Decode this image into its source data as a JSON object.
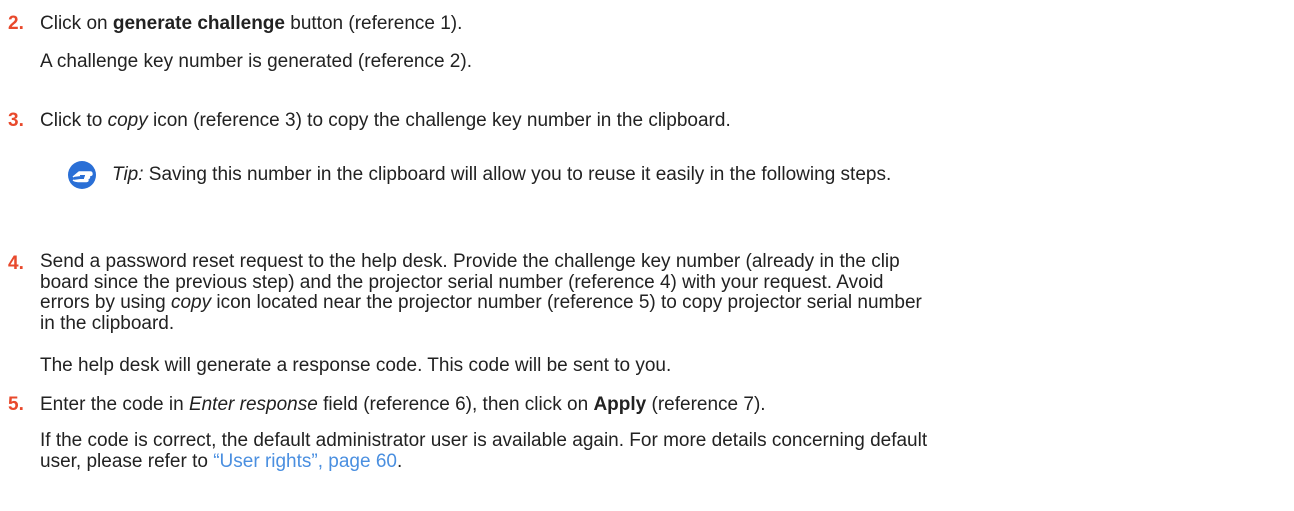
{
  "step2": {
    "number": "2.",
    "line1": {
      "pre": "Click on ",
      "bold": "generate challenge",
      "post": " button (reference 1)."
    },
    "line2": "A challenge key number is generated (reference 2)."
  },
  "step3": {
    "number": "3.",
    "line1": {
      "pre": "Click to ",
      "italic": "copy",
      "post": " icon (reference 3) to copy the challenge key number in the clipboard."
    },
    "tip": {
      "icon": "pointing-hand-icon",
      "label": "Tip:",
      "text": " Saving this number in the clipboard will allow you to reuse it easily in the following steps."
    }
  },
  "step4": {
    "number": "4.",
    "lines": [
      "Send a password reset request to the help desk. Provide the challenge key number (already in the clip",
      "board since the previous step) and the projector serial number (reference 4) with your request. Avoid"
    ],
    "line3": {
      "pre": "errors by using ",
      "italic": "copy",
      "post": " icon located near the projector number (reference 5) to copy projector serial number"
    },
    "line4": "in the clipboard.",
    "note": "The help desk will generate a response code. This code will be sent to you."
  },
  "step5": {
    "number": "5.",
    "line1": {
      "pre": "Enter the code in ",
      "italic": "Enter response",
      "mid": " field (reference 6), then click on ",
      "bold": "Apply",
      "post": " (reference 7)."
    },
    "line2": "If the code is correct, the default administrator user is available again. For more details concerning default",
    "line3": {
      "pre": "user, please refer to ",
      "link": "“User rights”, page 60",
      "post": "."
    }
  },
  "colors": {
    "step_number": "#e8492c",
    "link": "#4a8fe0",
    "tip_icon": "#2a6fd6"
  }
}
